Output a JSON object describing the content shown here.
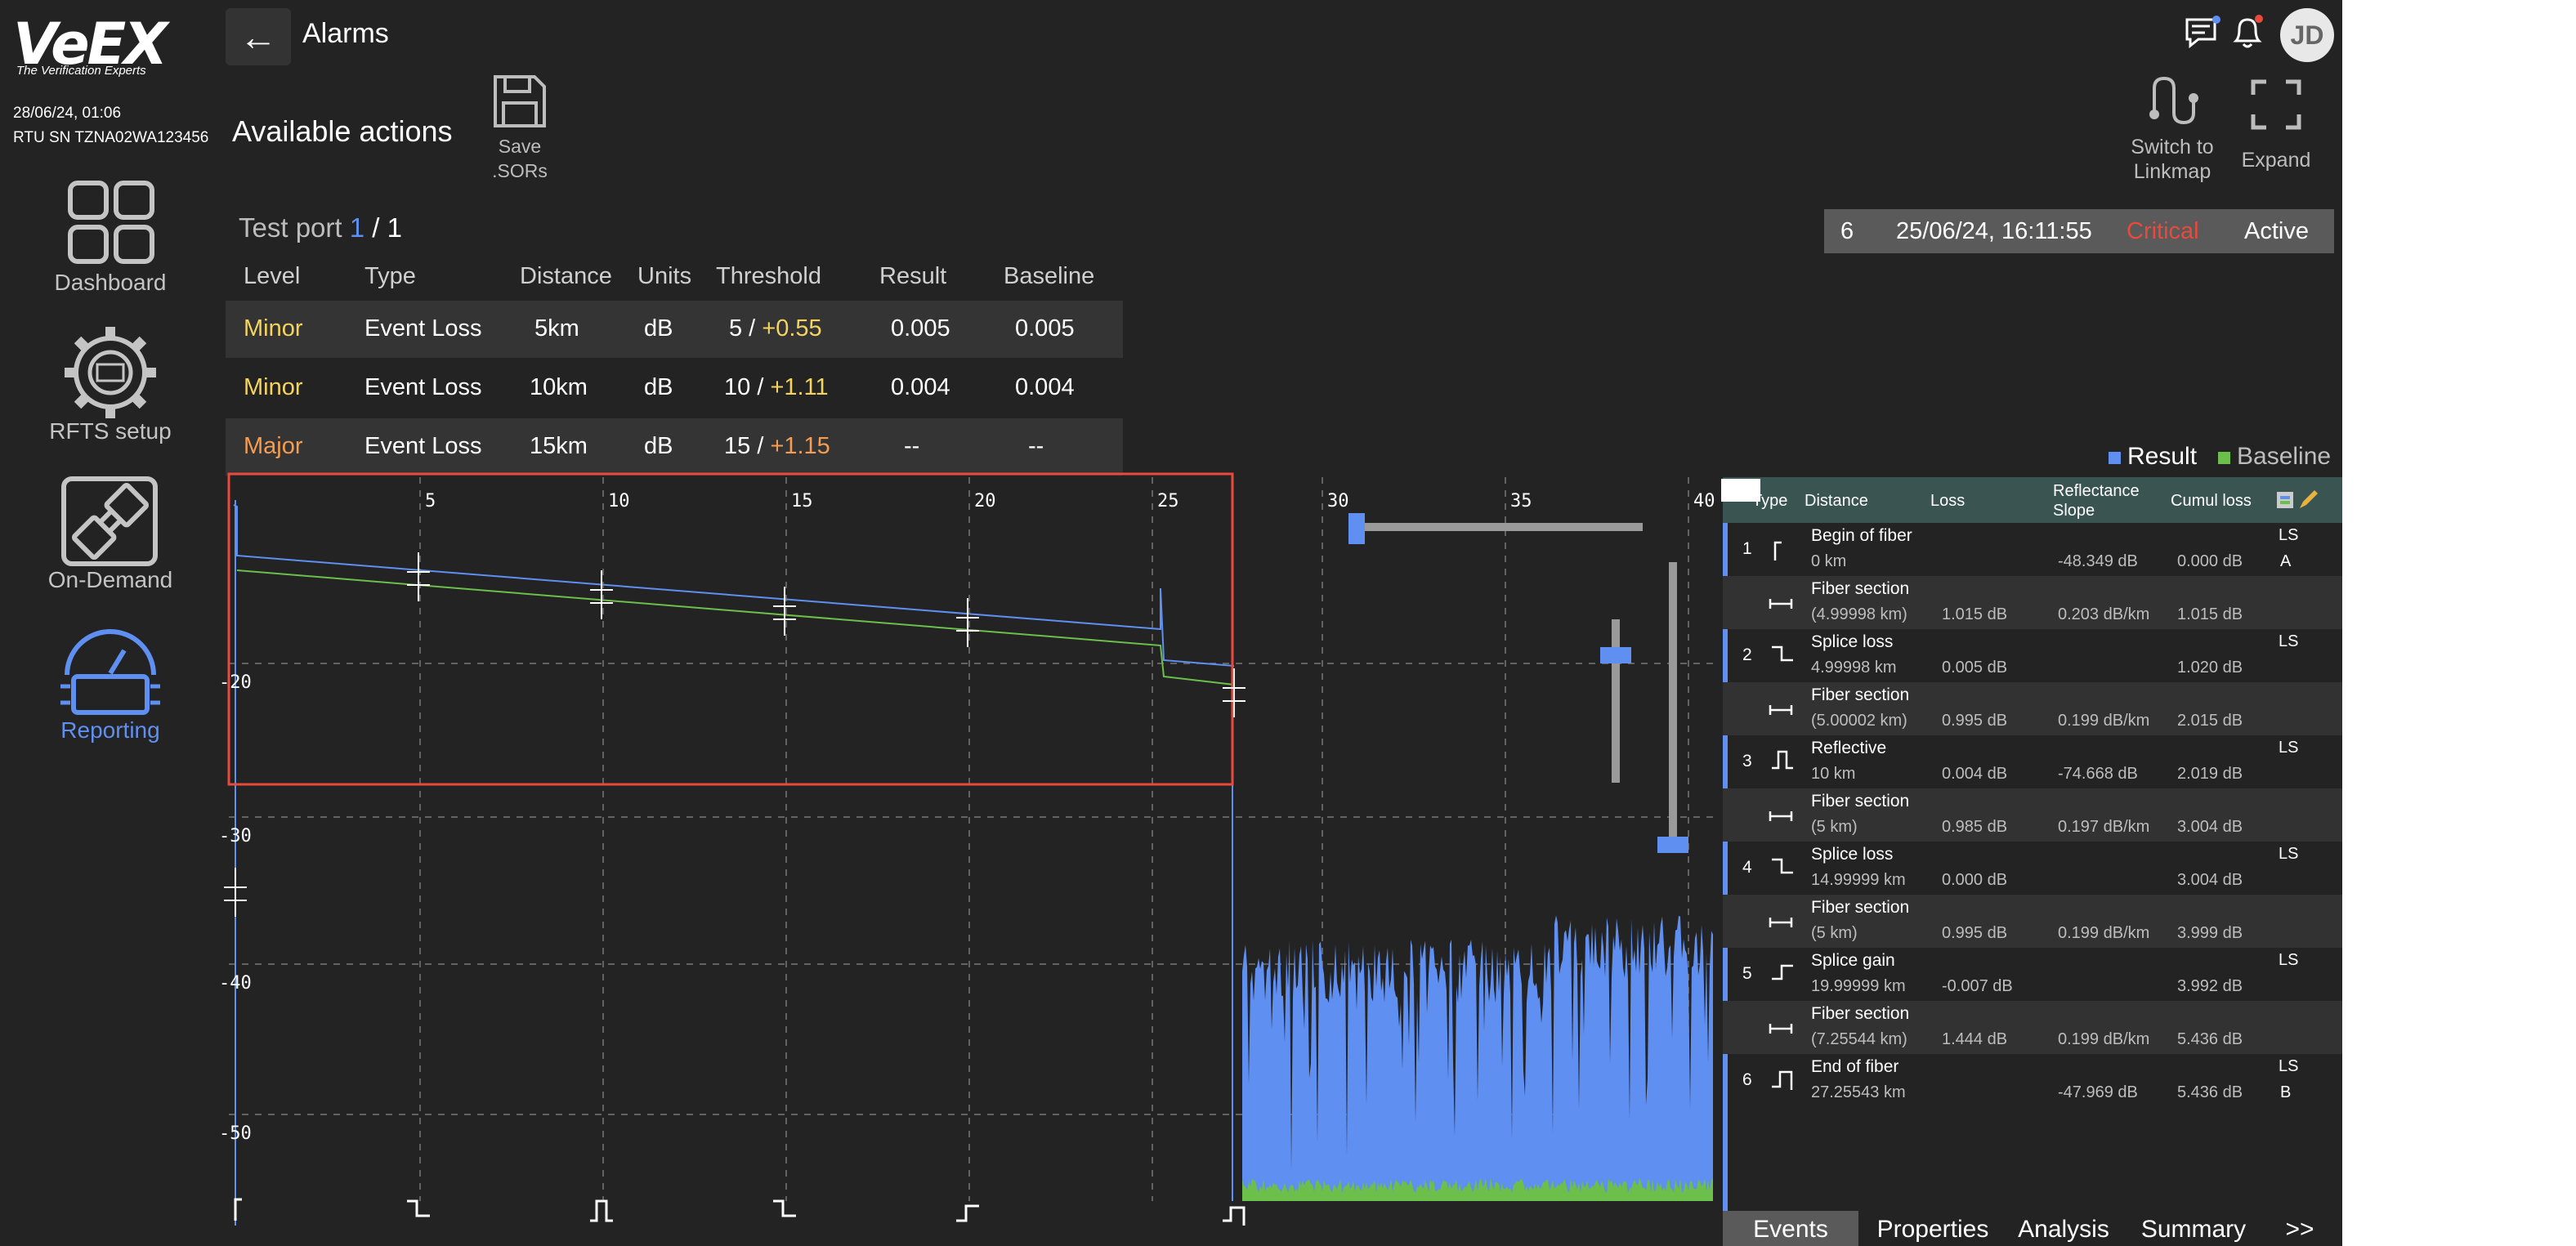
{
  "sidebar": {
    "logo_text": "VeEX",
    "logo_tagline": "The Verification Experts",
    "datetime": "28/06/24, 01:06",
    "rtu_sn": "RTU SN TZNA02WA123456",
    "items": [
      {
        "label": "Dashboard"
      },
      {
        "label": "RFTS setup"
      },
      {
        "label": "On-Demand"
      },
      {
        "label": "Reporting"
      }
    ],
    "active_color": "#5f8ff0"
  },
  "header": {
    "back_symbol": "←",
    "title": "Alarms",
    "avatar_initials": "JD"
  },
  "actions": {
    "title": "Available actions",
    "save_line1": "Save",
    "save_line2": ".SORs"
  },
  "tools": {
    "switch_line1": "Switch to",
    "switch_line2": "Linkmap",
    "expand": "Expand"
  },
  "status": {
    "id": "6",
    "timestamp": "25/06/24, 16:11:55",
    "severity": "Critical",
    "state": "Active",
    "severity_color": "#e84a3c"
  },
  "test_port": {
    "label": "Test port",
    "current": "1",
    "separator": "/",
    "total": "1"
  },
  "alarm_table": {
    "headers": [
      "Level",
      "Type",
      "Distance",
      "Units",
      "Threshold",
      "Result",
      "Baseline"
    ],
    "rows": [
      {
        "level": "Minor",
        "type": "Event Loss",
        "distance": "5km",
        "units": "dB",
        "threshold_base": "5 /",
        "threshold_delta": "+0.55",
        "result": "0.005",
        "baseline": "0.005"
      },
      {
        "level": "Minor",
        "type": "Event Loss",
        "distance": "10km",
        "units": "dB",
        "threshold_base": "10 /",
        "threshold_delta": "+1.11",
        "result": "0.004",
        "baseline": "0.004"
      },
      {
        "level": "Major",
        "type": "Event Loss",
        "distance": "15km",
        "units": "dB",
        "threshold_base": "15 /",
        "threshold_delta": "+1.15",
        "result": "--",
        "baseline": "--"
      }
    ]
  },
  "chart_data": {
    "type": "line",
    "x_ticks": [
      "5",
      "10",
      "15",
      "20",
      "25",
      "30",
      "35",
      "40"
    ],
    "y_ticks": [
      "-20",
      "-30",
      "-40",
      "-50"
    ],
    "series": [
      {
        "name": "Result",
        "color": "#5f8ff0"
      },
      {
        "name": "Baseline",
        "color": "#6cbf4a"
      }
    ],
    "grid": true,
    "legend_position": "top-right"
  },
  "events": {
    "headers": {
      "type": "Type",
      "distance": "Distance",
      "loss": "Loss",
      "reflectance_1": "Reflectance",
      "reflectance_2": "Slope",
      "cumul": "Cumul loss"
    },
    "rows": [
      {
        "idx": "1",
        "icon": "begin-icon",
        "name": "Begin of fiber",
        "distance": "0 km",
        "loss": "",
        "refl": "-48.349 dB",
        "cumul": "0.000 dB",
        "tag1": "LS",
        "tag2": "A"
      },
      {
        "idx": "",
        "icon": "section-icon",
        "name": "Fiber section",
        "distance": "(4.99998 km)",
        "loss": "1.015 dB",
        "refl": "0.203 dB/km",
        "cumul": "1.015 dB",
        "tag1": "",
        "tag2": ""
      },
      {
        "idx": "2",
        "icon": "splice-loss-icon",
        "name": "Splice loss",
        "distance": "4.99998 km",
        "loss": "0.005 dB",
        "refl": "",
        "cumul": "1.020 dB",
        "tag1": "LS",
        "tag2": ""
      },
      {
        "idx": "",
        "icon": "section-icon",
        "name": "Fiber section",
        "distance": "(5.00002 km)",
        "loss": "0.995 dB",
        "refl": "0.199 dB/km",
        "cumul": "2.015 dB",
        "tag1": "",
        "tag2": ""
      },
      {
        "idx": "3",
        "icon": "reflective-icon",
        "name": "Reflective",
        "distance": "10 km",
        "loss": "0.004 dB",
        "refl": "-74.668 dB",
        "cumul": "2.019 dB",
        "tag1": "LS",
        "tag2": ""
      },
      {
        "idx": "",
        "icon": "section-icon",
        "name": "Fiber section",
        "distance": "(5 km)",
        "loss": "0.985 dB",
        "refl": "0.197 dB/km",
        "cumul": "3.004 dB",
        "tag1": "",
        "tag2": ""
      },
      {
        "idx": "4",
        "icon": "splice-loss-icon",
        "name": "Splice loss",
        "distance": "14.99999 km",
        "loss": "0.000 dB",
        "refl": "",
        "cumul": "3.004 dB",
        "tag1": "LS",
        "tag2": ""
      },
      {
        "idx": "",
        "icon": "section-icon",
        "name": "Fiber section",
        "distance": "(5 km)",
        "loss": "0.995 dB",
        "refl": "0.199 dB/km",
        "cumul": "3.999 dB",
        "tag1": "",
        "tag2": ""
      },
      {
        "idx": "5",
        "icon": "splice-gain-icon",
        "name": "Splice gain",
        "distance": "19.99999 km",
        "loss": "-0.007 dB",
        "refl": "",
        "cumul": "3.992 dB",
        "tag1": "LS",
        "tag2": ""
      },
      {
        "idx": "",
        "icon": "section-icon",
        "name": "Fiber section",
        "distance": "(7.25544 km)",
        "loss": "1.444 dB",
        "refl": "0.199 dB/km",
        "cumul": "5.436 dB",
        "tag1": "",
        "tag2": ""
      },
      {
        "idx": "6",
        "icon": "end-icon",
        "name": "End of fiber",
        "distance": "27.25543 km",
        "loss": "",
        "refl": "-47.969 dB",
        "cumul": "5.436 dB",
        "tag1": "LS",
        "tag2": "B"
      }
    ],
    "tabs": [
      "Events",
      "Properties",
      "Analysis",
      "Summary",
      ">>"
    ]
  }
}
